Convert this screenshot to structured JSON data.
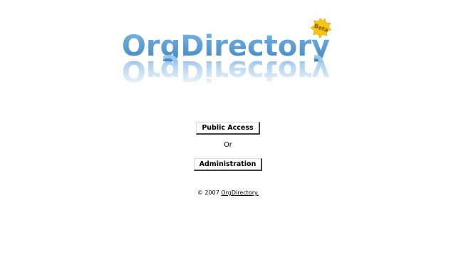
{
  "logo": {
    "text": "OrgDirectory",
    "badge": "Beta",
    "color": "#4a90c8",
    "badge_color": "#f5c518"
  },
  "actions": {
    "public_access_label": "Public Access",
    "separator": "Or",
    "administration_label": "Administration"
  },
  "footer": {
    "copyright": "© 2007",
    "link_text": "OrgDirectory."
  }
}
